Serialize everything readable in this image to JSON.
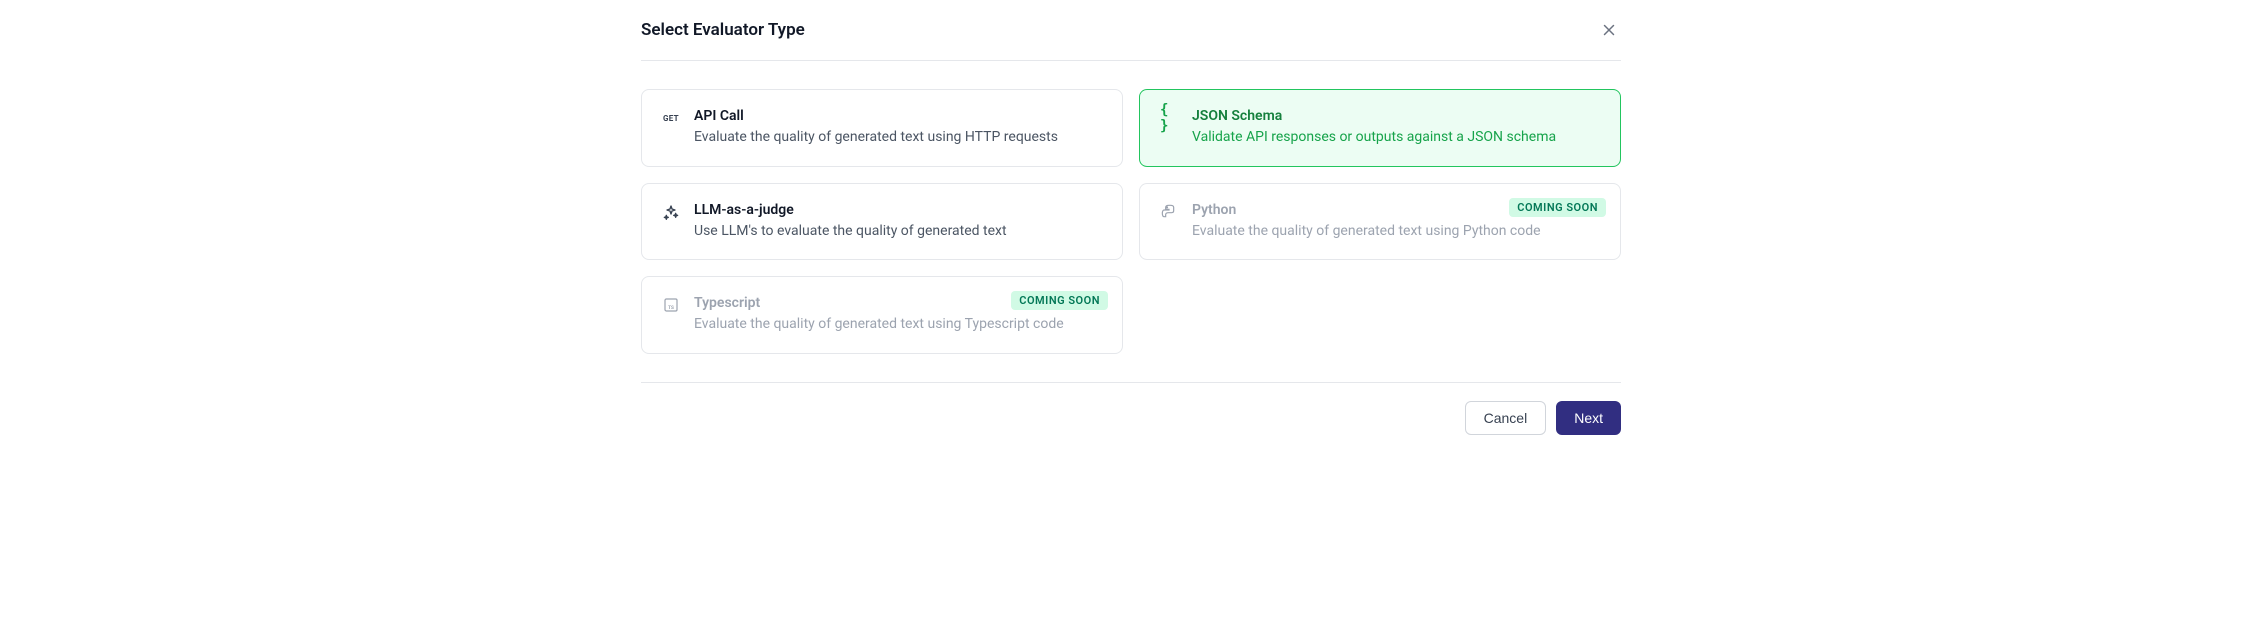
{
  "header": {
    "title": "Select Evaluator Type"
  },
  "options": {
    "api_call": {
      "title": "API Call",
      "description": "Evaluate the quality of generated text using HTTP requests",
      "icon_label": "GET"
    },
    "json_schema": {
      "title": "JSON Schema",
      "description": "Validate API responses or outputs against a JSON schema",
      "icon_label": "{ }"
    },
    "llm_judge": {
      "title": "LLM-as-a-judge",
      "description": "Use LLM's to evaluate the quality of generated text"
    },
    "python": {
      "title": "Python",
      "description": "Evaluate the quality of generated text using Python code",
      "badge": "COMING SOON"
    },
    "typescript": {
      "title": "Typescript",
      "description": "Evaluate the quality of generated text using Typescript code",
      "badge": "COMING SOON"
    }
  },
  "footer": {
    "cancel": "Cancel",
    "next": "Next"
  }
}
